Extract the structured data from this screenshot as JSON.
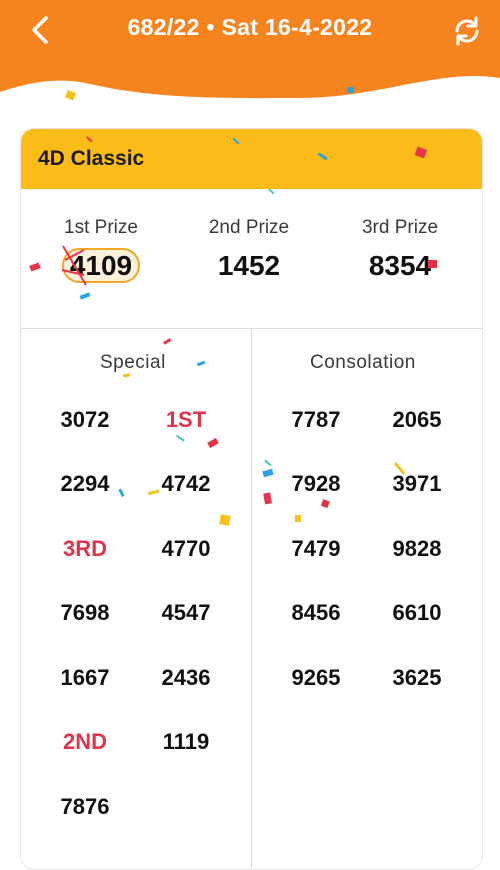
{
  "header": {
    "title": "682/22 • Sat 16-4-2022",
    "colors": {
      "background": "#f5841f",
      "text": "#ffffff"
    }
  },
  "card": {
    "title": "4D Classic",
    "header_color": "#fbbc18",
    "top_prizes": [
      {
        "label": "1st Prize",
        "number": "4109"
      },
      {
        "label": "2nd Prize",
        "number": "1452"
      },
      {
        "label": "3rd Prize",
        "number": "8354"
      }
    ],
    "special": {
      "title": "Special",
      "numbers": [
        "3072",
        "1ST",
        "2294",
        "4742",
        "3RD",
        "4770",
        "7698",
        "4547",
        "1667",
        "2436",
        "2ND",
        "1119",
        "7876"
      ]
    },
    "consolation": {
      "title": "Consolation",
      "numbers": [
        "7787",
        "2065",
        "7928",
        "3971",
        "7479",
        "9828",
        "8456",
        "6610",
        "9265",
        "3625"
      ]
    }
  },
  "accent_red": "#e0344a"
}
